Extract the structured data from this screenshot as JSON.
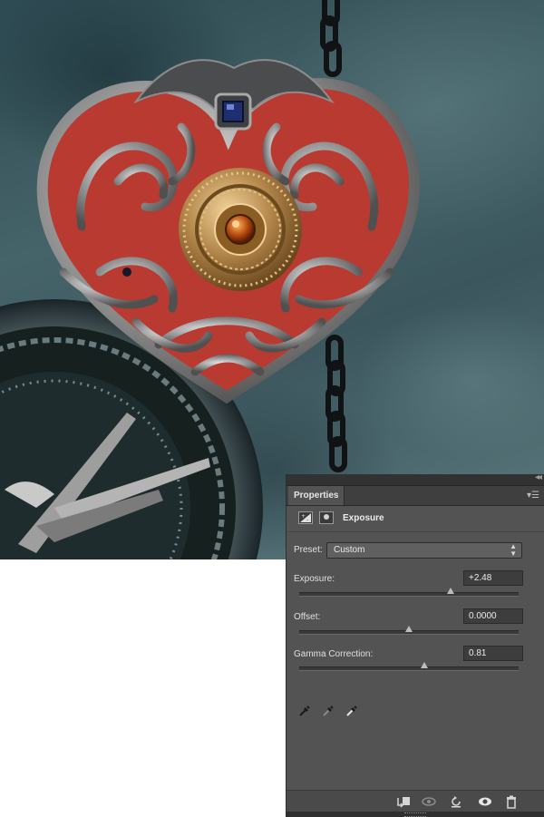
{
  "panel": {
    "tab_label": "Properties",
    "adjustment_title": "Exposure",
    "preset": {
      "label": "Preset:",
      "value": "Custom"
    },
    "properties": [
      {
        "label": "Exposure:",
        "value": "+2.48",
        "slider_fraction": 0.69
      },
      {
        "label": "Offset:",
        "value": "0.0000",
        "slider_fraction": 0.5
      },
      {
        "label": "Gamma Correction:",
        "value": "0.81",
        "slider_fraction": 0.57
      }
    ],
    "icons": {
      "adjustment_icon": "exposure-adjustment-icon",
      "mask_icon": "layer-mask-icon",
      "eyedroppers": [
        "black-point-eyedropper-icon",
        "gray-point-eyedropper-icon",
        "white-point-eyedropper-icon"
      ],
      "bottom": [
        "clip-to-layer-icon",
        "view-previous-state-icon",
        "reset-icon",
        "toggle-visibility-icon",
        "delete-icon"
      ]
    }
  },
  "colors": {
    "panel_bg": "#535353",
    "panel_dark": "#323232",
    "heart_red": "#b83a30",
    "metal_silver": "#a9a9a9",
    "brass": "#b58a45",
    "gem_blue": "#1d2f70"
  }
}
